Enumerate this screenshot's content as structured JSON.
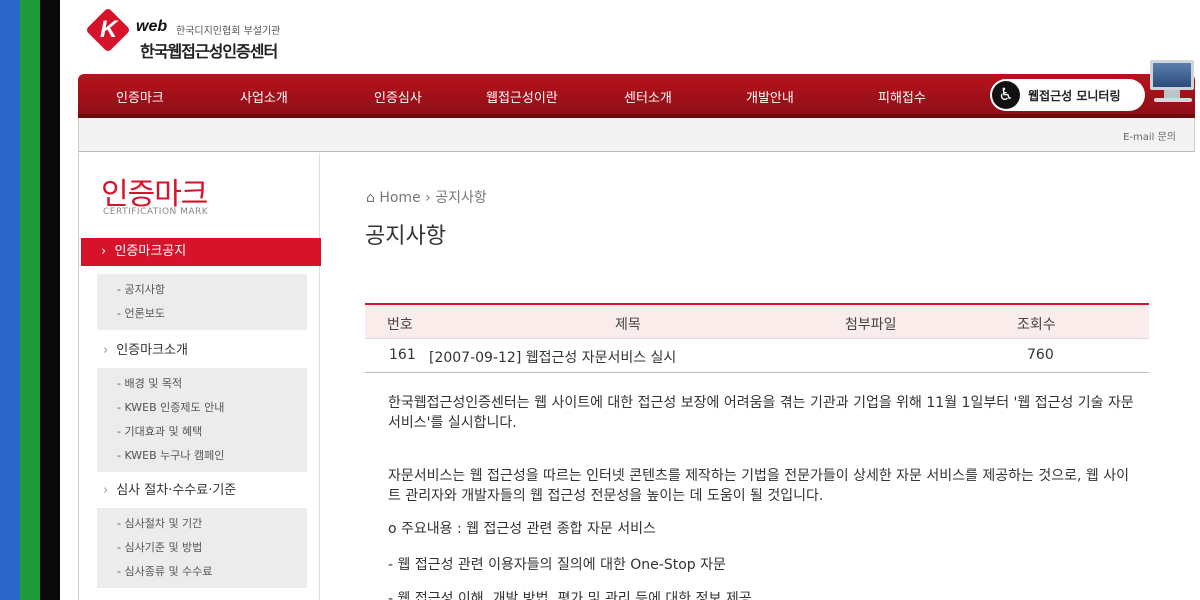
{
  "colors": {
    "accent": "#d7132b",
    "nav_bg": "#a8121b",
    "stripe_blue": "#2a67c8",
    "stripe_green": "#1e9a3a",
    "stripe_black": "#0a0a0a"
  },
  "header": {
    "logo_letter": "K",
    "logo_web": "web",
    "logo_subtitle": "한국디지인협회 부설기관",
    "logo_name": "한국웹접근성인증센터"
  },
  "nav": {
    "items": [
      "인증마크",
      "사업소개",
      "인증심사",
      "웹접근성이란",
      "센터소개",
      "개발안내",
      "피해접수"
    ],
    "monitor_label": "웹접근성 모니터링",
    "wheelchair_icon": "wheelchair-icon",
    "computer_icon": "computer-icon"
  },
  "subbar": {
    "email_link": "E-mail 문의"
  },
  "sidebar": {
    "title": "인증마크",
    "title_en": "CERTIFICATION MARK",
    "active": "인증마크공지",
    "groups": [
      {
        "items": [
          "- 공지사항",
          "- 언론보도"
        ]
      },
      {
        "heading": "인증마크소개",
        "items": [
          "- 배경 및 목적",
          "- KWEB 인증제도 안내",
          "- 기대효과 및 혜택",
          "- KWEB 누구나 캠페인"
        ]
      },
      {
        "heading": "심사 절차·수수료·기준",
        "items": [
          "- 심사절차 및 기간",
          "- 심사기준 및 방법",
          "- 심사종류 및 수수료"
        ]
      }
    ]
  },
  "main": {
    "breadcrumb": {
      "home": "Home",
      "current": "공지사항"
    },
    "title": "공지사항",
    "table": {
      "headers": [
        "번호",
        "제목",
        "첨부파일",
        "조회수"
      ],
      "row": {
        "number": "161",
        "title": "[2007-09-12] 웹접근성 자문서비스 실시",
        "views": "760"
      }
    },
    "paragraphs": [
      "한국웹접근성인증센터는 웹 사이트에 대한 접근성 보장에 어려움을 겪는 기관과 기업을 위해 11월 1일부터 '웹 접근성 기술 자문서비스'를 실시합니다.",
      "자문서비스는 웹 접근성을 따르는 인터넷 콘텐츠를 제작하는 기법을 전문가들이 상세한 자문 서비스를 제공하는 것으로, 웹 사이트 관리자와 개발자들의 웹 접근성 전문성을 높이는 데 도움이 될 것입니다.",
      "o 주요내용 : 웹 접근성 관련 종합 자문 서비스",
      "- 웹 접근성 관련 이용자들의 질의에 대한 One-Stop 자문",
      "- 웹 접근성 이해, 개발 방법, 평가 및 관리 등에 대한 정보 제공"
    ]
  }
}
